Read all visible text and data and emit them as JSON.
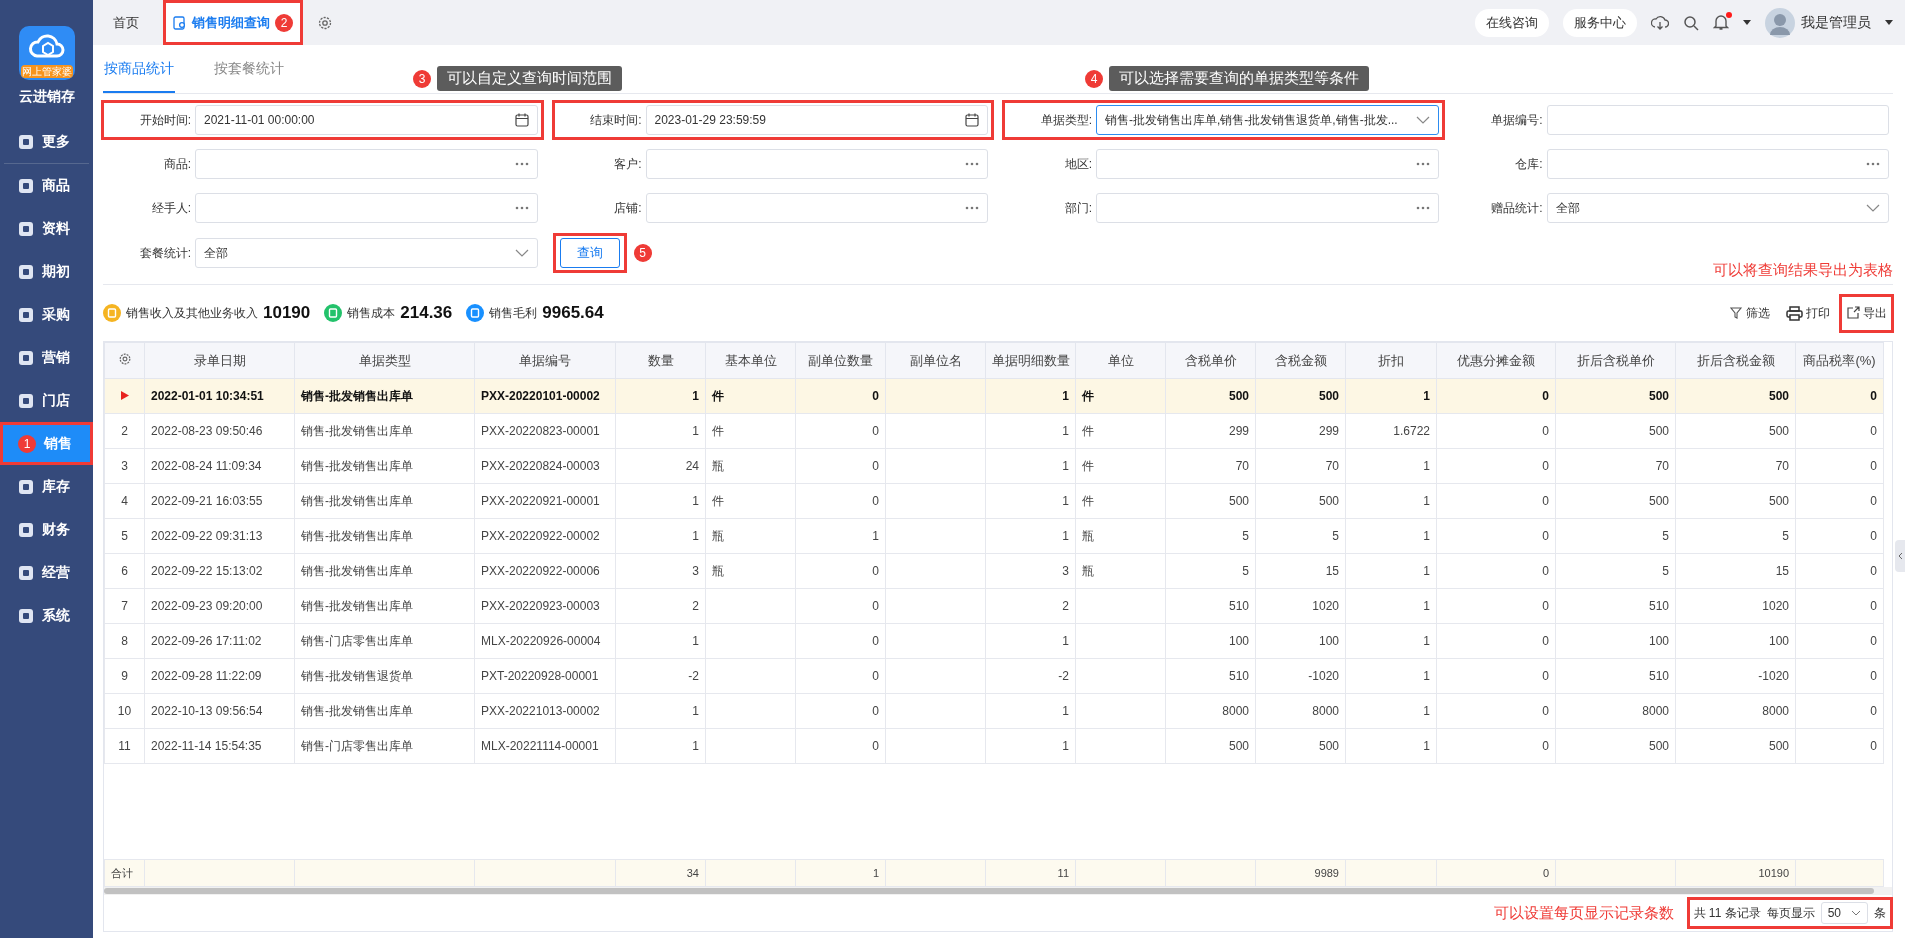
{
  "sidebar": {
    "logo_badge": "网上管家婆",
    "app_name": "云进销存",
    "items": [
      {
        "label": "更多",
        "selected": false,
        "highlighted": false
      },
      {
        "label": "商品",
        "selected": false,
        "highlighted": false
      },
      {
        "label": "资料",
        "selected": false,
        "highlighted": false
      },
      {
        "label": "期初",
        "selected": false,
        "highlighted": false
      },
      {
        "label": "采购",
        "selected": false,
        "highlighted": false
      },
      {
        "label": "营销",
        "selected": false,
        "highlighted": false
      },
      {
        "label": "门店",
        "selected": false,
        "highlighted": false
      },
      {
        "label": "销售",
        "selected": true,
        "highlighted": true,
        "badge": "1"
      },
      {
        "label": "库存",
        "selected": false,
        "highlighted": false
      },
      {
        "label": "财务",
        "selected": false,
        "highlighted": false
      },
      {
        "label": "经营",
        "selected": false,
        "highlighted": false
      },
      {
        "label": "系统",
        "selected": false,
        "highlighted": false
      }
    ]
  },
  "topbar": {
    "tabs": [
      {
        "label": "首页",
        "selected": false,
        "highlighted": false
      },
      {
        "label": "销售明细查询",
        "selected": true,
        "highlighted": true,
        "badge": "2"
      }
    ],
    "actions": [
      "在线咨询",
      "服务中心"
    ],
    "notification": true,
    "user": "我是管理员"
  },
  "subtabs": [
    {
      "label": "按商品统计",
      "selected": true
    },
    {
      "label": "按套餐统计",
      "selected": false
    }
  ],
  "callouts": [
    {
      "number": "3",
      "text": "可以自定义查询时间范围"
    },
    {
      "number": "4",
      "text": "可以选择需要查询的单据类型等条件"
    }
  ],
  "filters": [
    {
      "label": "开始时间:",
      "kind": "date",
      "value": "2021-11-01 00:00:00",
      "highlighted": true
    },
    {
      "label": "结束时间:",
      "kind": "date",
      "value": "2023-01-29 23:59:59",
      "highlighted": true
    },
    {
      "label": "单据类型:",
      "kind": "select",
      "value": "销售-批发销售出库单,销售-批发销售退货单,销售-批发...",
      "highlighted": true,
      "focused": true
    },
    {
      "label": "单据编号:",
      "kind": "text",
      "highlighted": false
    },
    {
      "label": "商品:",
      "kind": "picker",
      "highlighted": false
    },
    {
      "label": "客户:",
      "kind": "picker",
      "highlighted": false
    },
    {
      "label": "地区:",
      "kind": "picker",
      "highlighted": false
    },
    {
      "label": "仓库:",
      "kind": "picker",
      "highlighted": false
    },
    {
      "label": "经手人:",
      "kind": "picker",
      "highlighted": false
    },
    {
      "label": "店铺:",
      "kind": "picker",
      "highlighted": false
    },
    {
      "label": "部门:",
      "kind": "picker",
      "highlighted": false
    },
    {
      "label": "赠品统计:",
      "kind": "select",
      "value": "全部",
      "highlighted": false
    },
    {
      "label": "套餐统计:",
      "kind": "select",
      "value": "全部",
      "highlighted": false
    }
  ],
  "query_button": {
    "label": "查询",
    "badge": "5",
    "highlighted": true
  },
  "summary": [
    {
      "label": "销售收入及其他业务收入",
      "value": "10190",
      "color": "#f5b421"
    },
    {
      "label": "销售成本",
      "value": "214.36",
      "color": "#23c26b"
    },
    {
      "label": "销售毛利",
      "value": "9965.64",
      "color": "#1890ff"
    }
  ],
  "export_note": "可以将查询结果导出为表格",
  "toolbar": [
    {
      "label": "筛选",
      "kind": "filter",
      "highlighted": false
    },
    {
      "label": "打印",
      "kind": "print",
      "highlighted": false
    },
    {
      "label": "导出",
      "kind": "export",
      "highlighted": true
    }
  ],
  "table": {
    "columns": [
      {
        "label": "录单日期",
        "kind": "text"
      },
      {
        "label": "单据类型",
        "kind": "text"
      },
      {
        "label": "单据编号",
        "kind": "text"
      },
      {
        "label": "数量",
        "kind": "number"
      },
      {
        "label": "基本单位",
        "kind": "text"
      },
      {
        "label": "副单位数量",
        "kind": "number"
      },
      {
        "label": "副单位名",
        "kind": "text"
      },
      {
        "label": "单据明细数量",
        "kind": "number"
      },
      {
        "label": "单位",
        "kind": "text"
      },
      {
        "label": "含税单价",
        "kind": "number"
      },
      {
        "label": "含税金额",
        "kind": "number"
      },
      {
        "label": "折扣",
        "kind": "number"
      },
      {
        "label": "优惠分摊金额",
        "kind": "number"
      },
      {
        "label": "折后含税单价",
        "kind": "number"
      },
      {
        "label": "折后含税金额",
        "kind": "number"
      },
      {
        "label": "商品税率(%)",
        "kind": "number"
      }
    ],
    "rows": [
      {
        "selected": true,
        "cells": [
          "2022-01-01 10:34:51",
          "销售-批发销售出库单",
          "PXX-20220101-00002",
          "1",
          "件",
          "0",
          null,
          "1",
          "件",
          "500",
          "500",
          "1",
          "0",
          "500",
          "500",
          "0"
        ]
      },
      {
        "index": "2",
        "selected": false,
        "cells": [
          "2022-08-23 09:50:46",
          "销售-批发销售出库单",
          "PXX-20220823-00001",
          "1",
          "件",
          "0",
          null,
          "1",
          "件",
          "299",
          "299",
          "1.6722",
          "0",
          "500",
          "500",
          "0"
        ]
      },
      {
        "index": "3",
        "selected": false,
        "cells": [
          "2022-08-24 11:09:34",
          "销售-批发销售出库单",
          "PXX-20220824-00003",
          "24",
          "瓶",
          "0",
          null,
          "1",
          "件",
          "70",
          "70",
          "1",
          "0",
          "70",
          "70",
          "0"
        ]
      },
      {
        "index": "4",
        "selected": false,
        "cells": [
          "2022-09-21 16:03:55",
          "销售-批发销售出库单",
          "PXX-20220921-00001",
          "1",
          "件",
          "0",
          null,
          "1",
          "件",
          "500",
          "500",
          "1",
          "0",
          "500",
          "500",
          "0"
        ]
      },
      {
        "index": "5",
        "selected": false,
        "cells": [
          "2022-09-22 09:31:13",
          "销售-批发销售出库单",
          "PXX-20220922-00002",
          "1",
          "瓶",
          "1",
          null,
          "1",
          "瓶",
          "5",
          "5",
          "1",
          "0",
          "5",
          "5",
          "0"
        ]
      },
      {
        "index": "6",
        "selected": false,
        "cells": [
          "2022-09-22 15:13:02",
          "销售-批发销售出库单",
          "PXX-20220922-00006",
          "3",
          "瓶",
          "0",
          null,
          "3",
          "瓶",
          "5",
          "15",
          "1",
          "0",
          "5",
          "15",
          "0"
        ]
      },
      {
        "index": "7",
        "selected": false,
        "cells": [
          "2022-09-23 09:20:00",
          "销售-批发销售出库单",
          "PXX-20220923-00003",
          "2",
          null,
          "0",
          null,
          "2",
          null,
          "510",
          "1020",
          "1",
          "0",
          "510",
          "1020",
          "0"
        ]
      },
      {
        "index": "8",
        "selected": false,
        "cells": [
          "2022-09-26 17:11:02",
          "销售-门店零售出库单",
          "MLX-20220926-00004",
          "1",
          null,
          "0",
          null,
          "1",
          null,
          "100",
          "100",
          "1",
          "0",
          "100",
          "100",
          "0"
        ]
      },
      {
        "index": "9",
        "selected": false,
        "cells": [
          "2022-09-28 11:22:09",
          "销售-批发销售退货单",
          "PXT-20220928-00001",
          "-2",
          null,
          "0",
          null,
          "-2",
          null,
          "510",
          "-1020",
          "1",
          "0",
          "510",
          "-1020",
          "0"
        ]
      },
      {
        "index": "10",
        "selected": false,
        "cells": [
          "2022-10-13 09:56:54",
          "销售-批发销售出库单",
          "PXX-20221013-00002",
          "1",
          null,
          "0",
          null,
          "1",
          null,
          "8000",
          "8000",
          "1",
          "0",
          "8000",
          "8000",
          "0"
        ]
      },
      {
        "index": "11",
        "selected": false,
        "cells": [
          "2022-11-14 15:54:35",
          "销售-门店零售出库单",
          "MLX-20221114-00001",
          "1",
          null,
          "0",
          null,
          "1",
          null,
          "500",
          "500",
          "1",
          "0",
          "500",
          "500",
          "0"
        ]
      }
    ],
    "totals": {
      "label": "合计",
      "cells": [
        null,
        null,
        null,
        "34",
        null,
        "1",
        null,
        "11",
        null,
        null,
        "9989",
        null,
        "0",
        null,
        "10190",
        null
      ]
    }
  },
  "pagination": {
    "note": "可以设置每页显示记录条数",
    "total": "共 11 条记录",
    "page_size_label": "每页显示",
    "page_size": "50",
    "unit": "条",
    "highlighted": true
  }
}
